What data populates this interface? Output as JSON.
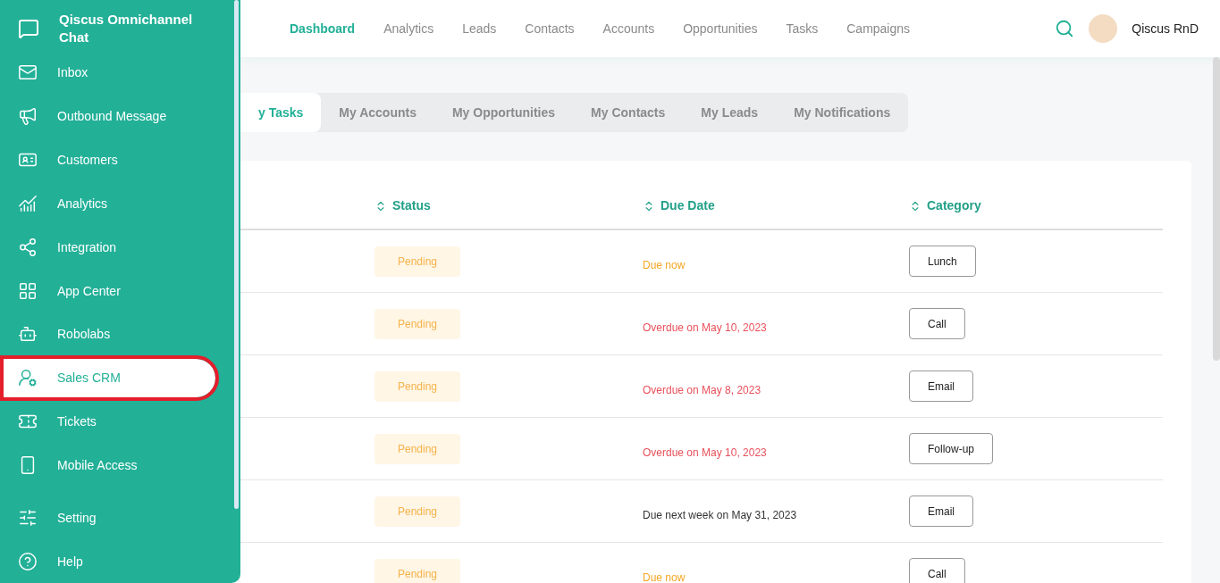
{
  "sidebar": {
    "title": "Qiscus Omnichannel Chat",
    "items": [
      {
        "label": "Inbox",
        "selected": false
      },
      {
        "label": "Outbound Message",
        "selected": false
      },
      {
        "label": "Customers",
        "selected": false
      },
      {
        "label": "Analytics",
        "selected": false
      },
      {
        "label": "Integration",
        "selected": false
      },
      {
        "label": "App Center",
        "selected": false
      },
      {
        "label": "Robolabs",
        "selected": false
      },
      {
        "label": "Sales CRM",
        "selected": true
      },
      {
        "label": "Tickets",
        "selected": false
      },
      {
        "label": "Mobile Access",
        "selected": false
      }
    ],
    "footer_items": [
      {
        "label": "Setting"
      },
      {
        "label": "Help"
      }
    ]
  },
  "top_nav": {
    "items": [
      {
        "label": "Dashboard",
        "selected": true
      },
      {
        "label": "Analytics",
        "selected": false
      },
      {
        "label": "Leads",
        "selected": false
      },
      {
        "label": "Contacts",
        "selected": false
      },
      {
        "label": "Accounts",
        "selected": false
      },
      {
        "label": "Opportunities",
        "selected": false
      },
      {
        "label": "Tasks",
        "selected": false
      },
      {
        "label": "Campaigns",
        "selected": false
      }
    ],
    "user": "Qiscus RnD"
  },
  "tabs": [
    {
      "label": "y Tasks",
      "selected": true
    },
    {
      "label": "My Accounts",
      "selected": false
    },
    {
      "label": "My Opportunities",
      "selected": false
    },
    {
      "label": "My Contacts",
      "selected": false
    },
    {
      "label": "My Leads",
      "selected": false
    },
    {
      "label": "My Notifications",
      "selected": false
    }
  ],
  "table": {
    "columns": [
      "Status",
      "Due Date",
      "Category"
    ],
    "rows": [
      {
        "status": "Pending",
        "due": "Due now",
        "color": "#f5a623",
        "category": "Lunch"
      },
      {
        "status": "Pending",
        "due": "Overdue on May 10, 2023",
        "color": "#e8505b",
        "category": "Call"
      },
      {
        "status": "Pending",
        "due": "Overdue on May 8, 2023",
        "color": "#e8505b",
        "category": "Email"
      },
      {
        "status": "Pending",
        "due": "Overdue on May 10, 2023",
        "color": "#e8505b",
        "category": "Follow-up"
      },
      {
        "status": "Pending",
        "due": "Due next week on May 31, 2023",
        "color": "#333333",
        "category": "Email"
      },
      {
        "status": "Pending",
        "due": "Due now",
        "color": "#f5a623",
        "category": "Call"
      }
    ]
  }
}
